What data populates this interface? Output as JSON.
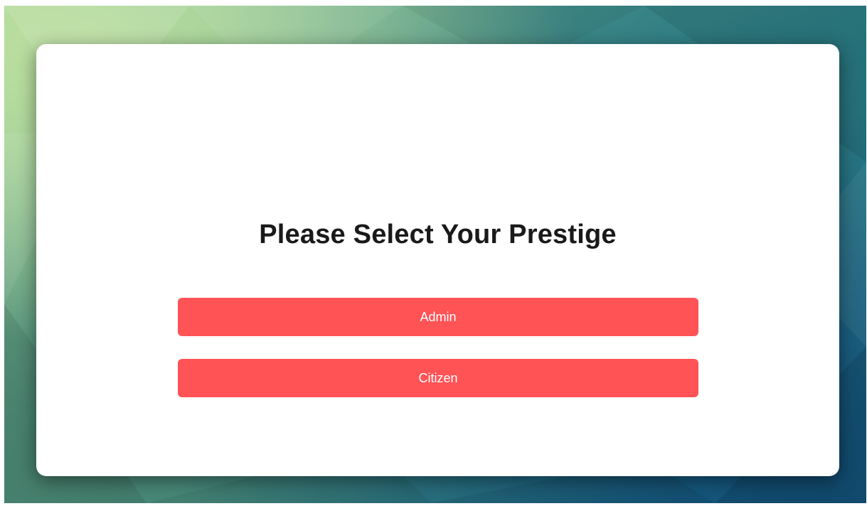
{
  "page": {
    "title": "Please Select Your Prestige"
  },
  "options": {
    "admin_label": "Admin",
    "citizen_label": "Citizen"
  },
  "colors": {
    "button": "#ff5356",
    "button_text": "#ffffff",
    "card": "#ffffff",
    "title": "#1a1a1a"
  }
}
